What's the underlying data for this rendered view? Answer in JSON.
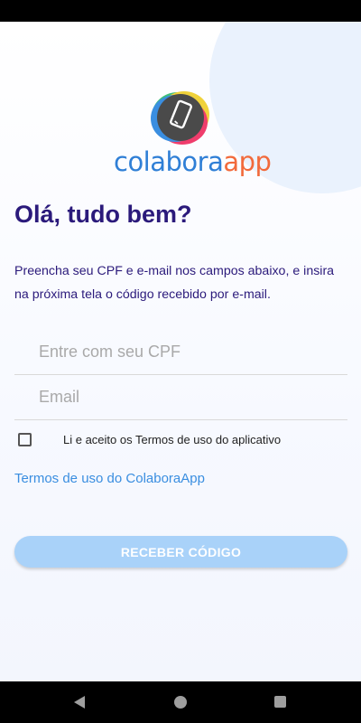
{
  "app": {
    "logo_text_part1": "colabora",
    "logo_text_part2": "app",
    "logo_icon": "smartphone-icon"
  },
  "screen": {
    "greeting": "Olá, tudo bem?",
    "instructions": "Preencha seu CPF e e-mail nos campos abaixo, e insira na próxima tela o código recebido por e-mail."
  },
  "form": {
    "cpf_placeholder": "Entre com seu CPF",
    "cpf_value": "",
    "email_placeholder": "Email",
    "email_value": "",
    "terms_checkbox_label": "Li e aceito os Termos de uso do aplicativo",
    "terms_checked": false,
    "terms_link": "Termos de uso do ColaboraApp",
    "submit_label": "RECEBER CÓDIGO"
  },
  "navigation": {
    "back_icon": "back-triangle-icon",
    "home_icon": "home-circle-icon",
    "recents_icon": "recents-square-icon"
  },
  "colors": {
    "primary_text": "#2b1a7b",
    "brand_blue": "#2f7fd6",
    "brand_orange": "#f26a3b",
    "link": "#3a8ee0",
    "button_disabled": "#a9d2f9"
  }
}
